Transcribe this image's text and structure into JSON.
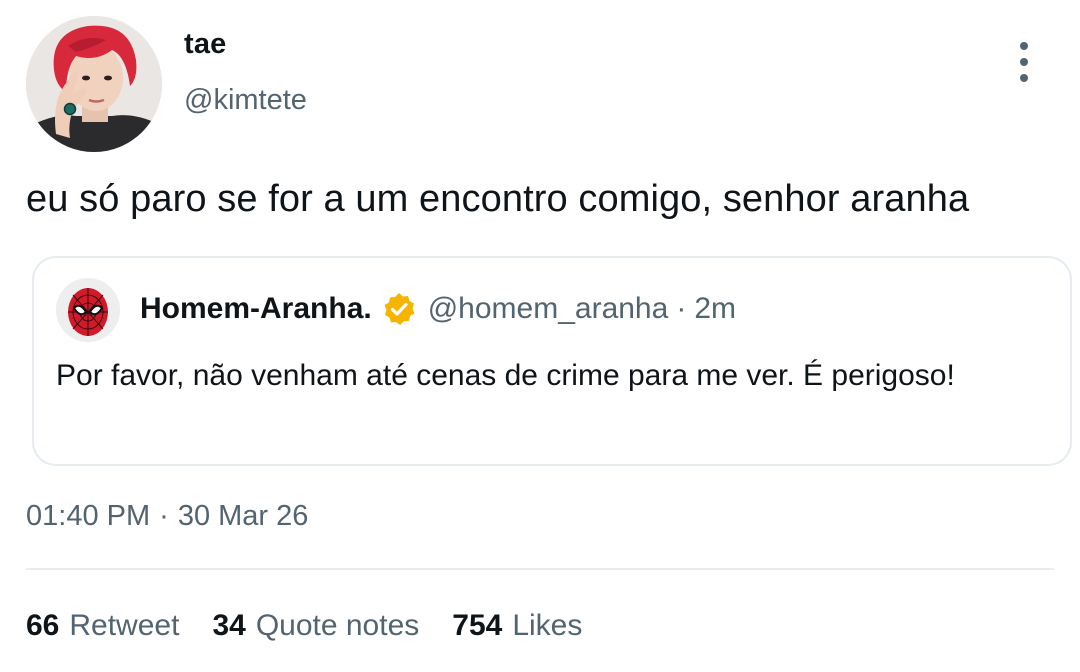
{
  "author": {
    "display_name": "tae",
    "handle": "@kimtete",
    "avatar_icon": "profile-photo-red-hair"
  },
  "tweet": {
    "text": "eu só paro se for a um encontro comigo, senhor aranha"
  },
  "quoted": {
    "display_name": "Homem-Aranha.",
    "handle": "@homem_aranha",
    "separator": "·",
    "time": "2m",
    "text": "Por favor, não venham até cenas de crime para me ver. É perigoso!",
    "verified_color": "#f4b400",
    "avatar_icon": "spider-man-mask"
  },
  "meta": {
    "time": "01:40 PM",
    "separator": "·",
    "date": "30 Mar 26"
  },
  "stats": {
    "retweets": "66",
    "retweets_label": "Retweet",
    "quotes": "34",
    "quotes_label": "Quote notes",
    "likes": "754",
    "likes_label": "Likes"
  },
  "colors": {
    "text_primary": "#0f1419",
    "text_secondary": "#536471",
    "border": "#e6ecf0",
    "avatar_hair": "#d8283c"
  }
}
